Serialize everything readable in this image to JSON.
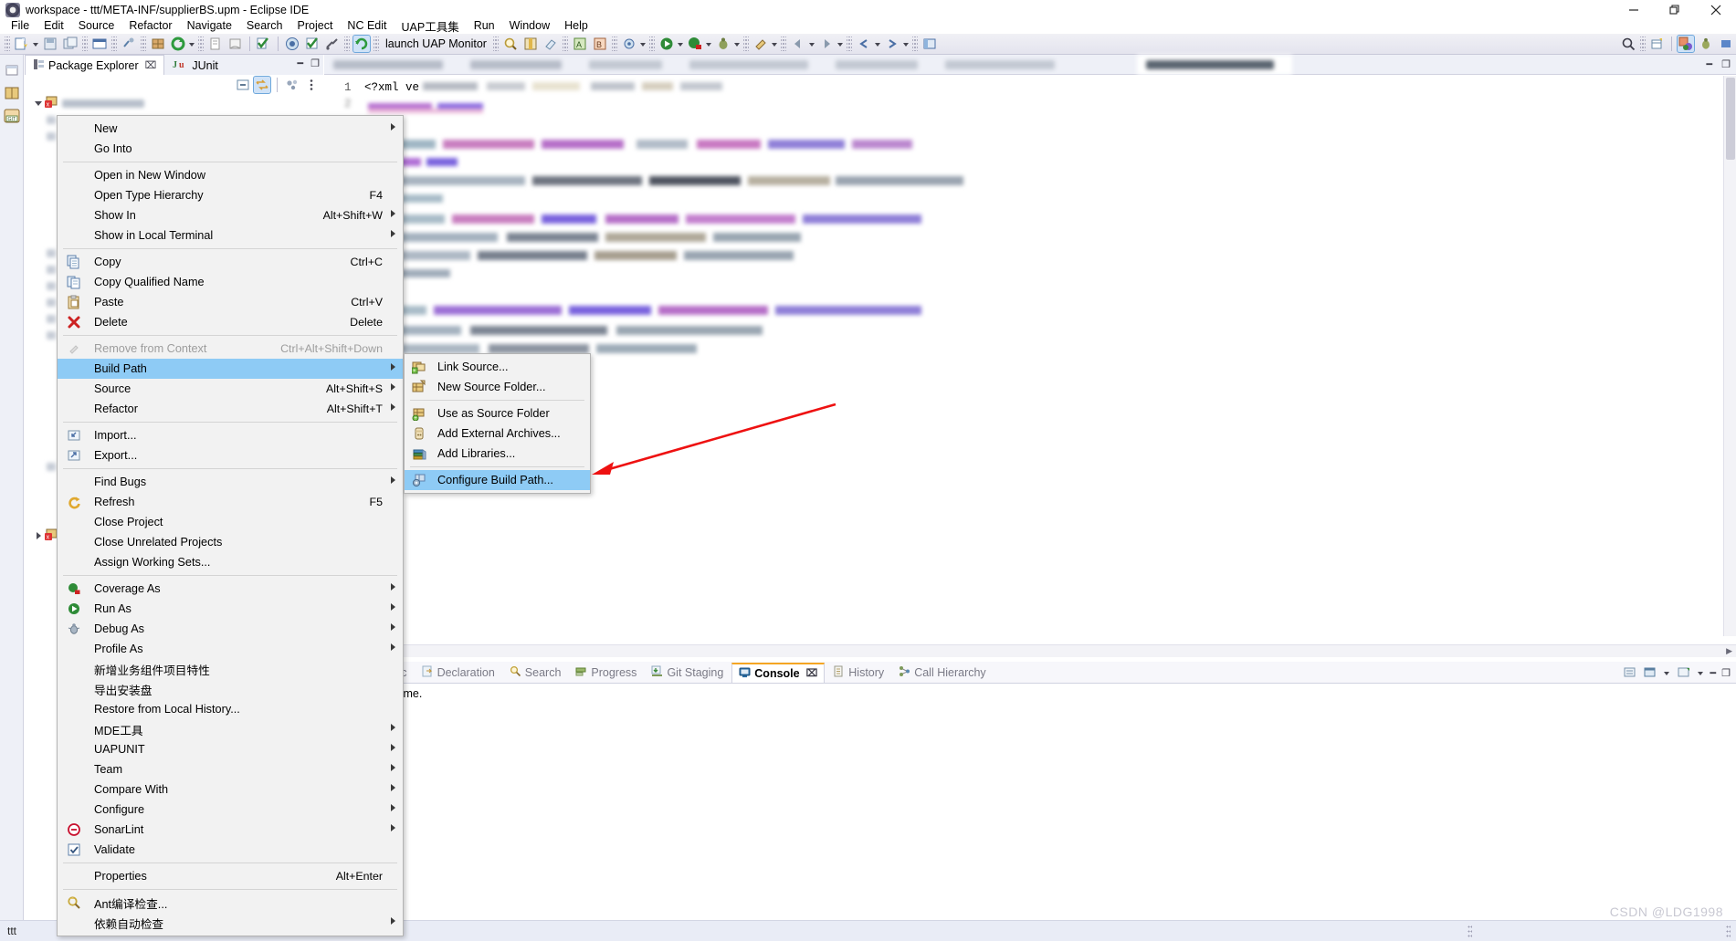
{
  "window": {
    "title": "workspace - ttt/META-INF/supplierBS.upm - Eclipse IDE",
    "icon": "eclipse-icon",
    "minimize": "–",
    "maximize": "❐",
    "close": "✕"
  },
  "menubar": {
    "items": [
      {
        "label": "File"
      },
      {
        "label": "Edit"
      },
      {
        "label": "Source"
      },
      {
        "label": "Refactor"
      },
      {
        "label": "Navigate"
      },
      {
        "label": "Search"
      },
      {
        "label": "Project"
      },
      {
        "label": "NC Edit"
      },
      {
        "label": "UAP工具集"
      },
      {
        "label": "Run"
      },
      {
        "label": "Window"
      },
      {
        "label": "Help"
      }
    ]
  },
  "toolbar": {
    "launch_label": "launch UAP Monitor"
  },
  "package_explorer": {
    "tabs": [
      {
        "label": "Package Explorer",
        "active": true,
        "icon": "package-explorer-icon",
        "close": "⌧"
      },
      {
        "label": "JUnit",
        "active": false,
        "icon": "junit-icon"
      }
    ],
    "view_minimize": "━",
    "view_maximize": "❐"
  },
  "editor": {
    "first_line_number": "1",
    "first_line_text": "<?xml ve",
    "second_line_number": "2"
  },
  "bottom_view": {
    "tabs": [
      {
        "label": "Javadoc",
        "active": false,
        "icon": "javadoc-icon"
      },
      {
        "label": "Declaration",
        "active": false,
        "icon": "declaration-icon"
      },
      {
        "label": "Search",
        "active": false,
        "icon": "search-icon"
      },
      {
        "label": "Progress",
        "active": false,
        "icon": "progress-icon"
      },
      {
        "label": "Git Staging",
        "active": false,
        "icon": "git-staging-icon"
      },
      {
        "label": "Console",
        "active": true,
        "icon": "console-icon",
        "close": "⌧"
      },
      {
        "label": "History",
        "active": false,
        "icon": "history-icon"
      },
      {
        "label": "Call Hierarchy",
        "active": false,
        "icon": "call-hierarchy-icon"
      }
    ],
    "content": "isplay at this time."
  },
  "status_bar": {
    "text": "ttt"
  },
  "watermark": "CSDN @LDG1998",
  "context_menu": {
    "groups": [
      {
        "items": [
          {
            "label": "New",
            "accel": "",
            "arrow": true,
            "icon": "",
            "disabled": false
          },
          {
            "label": "Go Into",
            "accel": "",
            "arrow": false,
            "icon": "",
            "disabled": false
          }
        ]
      },
      {
        "items": [
          {
            "label": "Open in New Window",
            "accel": "",
            "arrow": false,
            "icon": "",
            "disabled": false
          },
          {
            "label": "Open Type Hierarchy",
            "accel": "F4",
            "arrow": false,
            "icon": "",
            "disabled": false
          },
          {
            "label": "Show In",
            "accel": "Alt+Shift+W",
            "arrow": true,
            "icon": "",
            "disabled": false
          },
          {
            "label": "Show in Local Terminal",
            "accel": "",
            "arrow": true,
            "icon": "",
            "disabled": false
          }
        ]
      },
      {
        "items": [
          {
            "label": "Copy",
            "accel": "Ctrl+C",
            "arrow": false,
            "icon": "copy-icon",
            "disabled": false
          },
          {
            "label": "Copy Qualified Name",
            "accel": "",
            "arrow": false,
            "icon": "copy-qualified-name-icon",
            "disabled": false
          },
          {
            "label": "Paste",
            "accel": "Ctrl+V",
            "arrow": false,
            "icon": "paste-icon",
            "disabled": false
          },
          {
            "label": "Delete",
            "accel": "Delete",
            "arrow": false,
            "icon": "delete-icon",
            "disabled": false
          }
        ]
      },
      {
        "items": [
          {
            "label": "Remove from Context",
            "accel": "Ctrl+Alt+Shift+Down",
            "arrow": false,
            "icon": "remove-from-context-icon",
            "disabled": true
          },
          {
            "label": "Build Path",
            "accel": "",
            "arrow": true,
            "icon": "",
            "disabled": false,
            "selected": true
          },
          {
            "label": "Source",
            "accel": "Alt+Shift+S",
            "arrow": true,
            "icon": "",
            "disabled": false
          },
          {
            "label": "Refactor",
            "accel": "Alt+Shift+T",
            "arrow": true,
            "icon": "",
            "disabled": false
          }
        ]
      },
      {
        "items": [
          {
            "label": "Import...",
            "accel": "",
            "arrow": false,
            "icon": "import-icon",
            "disabled": false
          },
          {
            "label": "Export...",
            "accel": "",
            "arrow": false,
            "icon": "export-icon",
            "disabled": false
          }
        ]
      },
      {
        "items": [
          {
            "label": "Find Bugs",
            "accel": "",
            "arrow": true,
            "icon": "",
            "disabled": false
          },
          {
            "label": "Refresh",
            "accel": "F5",
            "arrow": false,
            "icon": "refresh-icon",
            "disabled": false
          },
          {
            "label": "Close Project",
            "accel": "",
            "arrow": false,
            "icon": "",
            "disabled": false
          },
          {
            "label": "Close Unrelated Projects",
            "accel": "",
            "arrow": false,
            "icon": "",
            "disabled": false
          },
          {
            "label": "Assign Working Sets...",
            "accel": "",
            "arrow": false,
            "icon": "",
            "disabled": false
          }
        ]
      },
      {
        "items": [
          {
            "label": "Coverage As",
            "accel": "",
            "arrow": true,
            "icon": "coverage-icon",
            "disabled": false
          },
          {
            "label": "Run As",
            "accel": "",
            "arrow": true,
            "icon": "run-icon",
            "disabled": false
          },
          {
            "label": "Debug As",
            "accel": "",
            "arrow": true,
            "icon": "debug-icon",
            "disabled": false
          },
          {
            "label": "Profile As",
            "accel": "",
            "arrow": true,
            "icon": "",
            "disabled": false
          },
          {
            "label": "新增业务组件项目特性",
            "accel": "",
            "arrow": false,
            "icon": "",
            "disabled": false
          },
          {
            "label": "导出安装盘",
            "accel": "",
            "arrow": false,
            "icon": "",
            "disabled": false
          },
          {
            "label": "Restore from Local History...",
            "accel": "",
            "arrow": false,
            "icon": "",
            "disabled": false
          },
          {
            "label": "MDE工具",
            "accel": "",
            "arrow": true,
            "icon": "",
            "disabled": false
          },
          {
            "label": "UAPUNIT",
            "accel": "",
            "arrow": true,
            "icon": "",
            "disabled": false
          },
          {
            "label": "Team",
            "accel": "",
            "arrow": true,
            "icon": "",
            "disabled": false
          },
          {
            "label": "Compare With",
            "accel": "",
            "arrow": true,
            "icon": "",
            "disabled": false
          },
          {
            "label": "Configure",
            "accel": "",
            "arrow": true,
            "icon": "",
            "disabled": false
          },
          {
            "label": "SonarLint",
            "accel": "",
            "arrow": true,
            "icon": "sonarlint-icon",
            "disabled": false
          },
          {
            "label": "Validate",
            "accel": "",
            "arrow": false,
            "icon": "validate-icon",
            "disabled": false
          }
        ]
      },
      {
        "items": [
          {
            "label": "Properties",
            "accel": "Alt+Enter",
            "arrow": false,
            "icon": "",
            "disabled": false
          }
        ]
      },
      {
        "items": [
          {
            "label": "Ant编译检查...",
            "accel": "",
            "arrow": false,
            "icon": "ant-build-check-icon",
            "disabled": false
          },
          {
            "label": "依赖自动检查",
            "accel": "",
            "arrow": true,
            "icon": "",
            "disabled": false
          }
        ]
      }
    ]
  },
  "build_path_submenu": {
    "groups": [
      {
        "items": [
          {
            "label": "Link Source...",
            "icon": "link-source-icon",
            "selected": false
          },
          {
            "label": "New Source Folder...",
            "icon": "new-source-folder-icon",
            "selected": false
          }
        ]
      },
      {
        "items": [
          {
            "label": "Use as Source Folder",
            "icon": "use-as-source-folder-icon",
            "selected": false
          },
          {
            "label": "Add External Archives...",
            "icon": "add-external-archives-icon",
            "selected": false
          },
          {
            "label": "Add Libraries...",
            "icon": "add-libraries-icon",
            "selected": false
          }
        ]
      },
      {
        "items": [
          {
            "label": "Configure Build Path...",
            "icon": "configure-build-path-icon",
            "selected": true
          }
        ]
      }
    ]
  },
  "annotation": {
    "arrow_color": "#ee1111"
  }
}
